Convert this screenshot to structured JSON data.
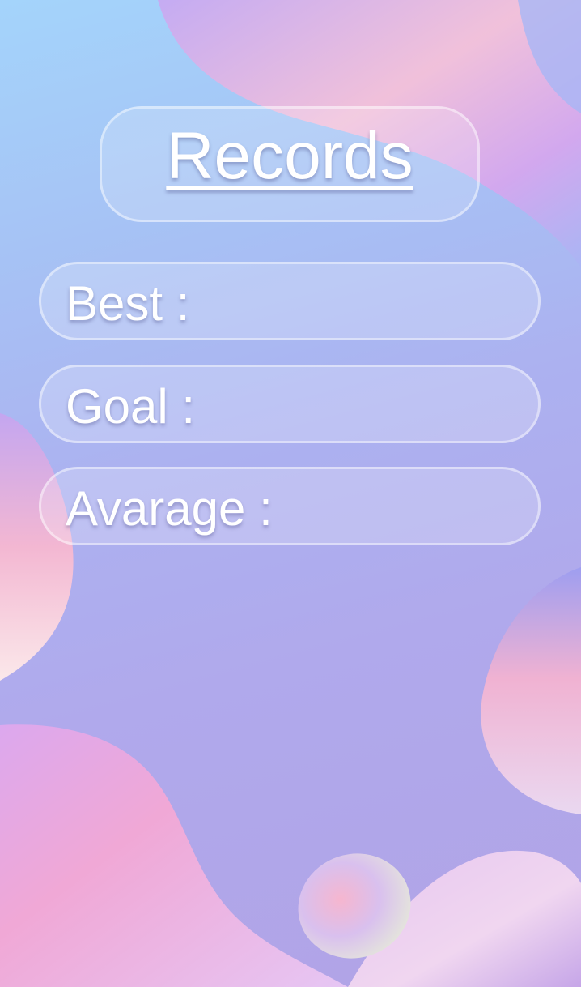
{
  "header": {
    "title": "Records"
  },
  "records": {
    "best": {
      "label": "Best :",
      "value": ""
    },
    "goal": {
      "label": "Goal :",
      "value": ""
    },
    "average": {
      "label": "Avarage :",
      "value": ""
    }
  },
  "colors": {
    "background_top": "#a4d4fb",
    "background_bottom": "#b1a3e6",
    "blob_pink": "#f5b6d6",
    "blob_violet": "#c9a6f0",
    "text": "#ffffff"
  }
}
